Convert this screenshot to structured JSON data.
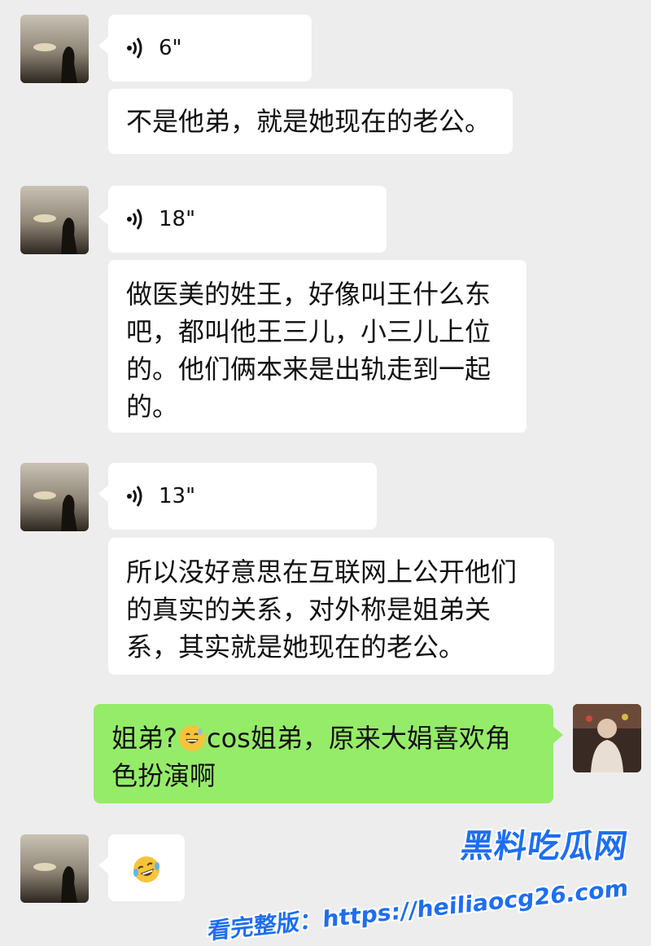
{
  "messages": [
    {
      "type": "voice",
      "duration": "6\""
    },
    {
      "type": "text",
      "text": "不是他弟，就是她现在的老公。"
    },
    {
      "type": "voice",
      "duration": "18\""
    },
    {
      "type": "text",
      "lines": [
        "做医美的姓王，好像叫王什么东",
        "吧，都叫他王三儿，小三儿上位",
        "的。他们俩本来是出轨走到一起",
        "的。"
      ]
    },
    {
      "type": "voice",
      "duration": "13\""
    },
    {
      "type": "text",
      "lines": [
        "所以没好意思在互联网上公开他们",
        "的真实的关系，对外称是姐弟关",
        "系，其实就是她现在的老公。"
      ]
    },
    {
      "type": "text_mine",
      "before_emoji": "姐弟?",
      "emoji": "grinning-sweat-emoji",
      "after_emoji": "cos姐弟，原来大娟喜欢角",
      "line2": "色扮演啊"
    },
    {
      "type": "emoji",
      "emoji": "laughing-crying-emoji"
    }
  ],
  "watermark": {
    "brand": "黑料吃瓜网",
    "url_text": "看完整版：https://heiliaocg26.com"
  },
  "colors": {
    "background": "#ededed",
    "bubble_other": "#ffffff",
    "bubble_mine": "#95ec69",
    "watermark": "#1d6ef2"
  }
}
